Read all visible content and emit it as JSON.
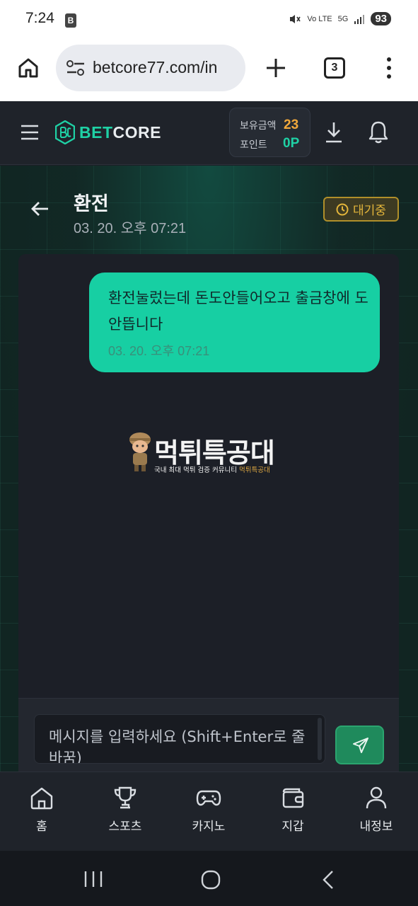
{
  "status_bar": {
    "time": "7:24",
    "app_badge": "B",
    "network": "5G",
    "volte": "Vo LTE",
    "battery": "93"
  },
  "browser": {
    "url": "betcore77.com/in",
    "tab_count": "3"
  },
  "header": {
    "logo_bet": "BET",
    "logo_core": "CORE",
    "balance_label": "보유금액",
    "balance_value": "23",
    "points_label": "포인트",
    "points_value": "0P"
  },
  "page": {
    "title": "환전",
    "timestamp": "03. 20. 오후 07:21",
    "status": "대기중",
    "status_color": "#e3b53b"
  },
  "messages": [
    {
      "text": "환전눌렀는데 돈도안들어오고 출금창에 도안뜹니다",
      "time": "03. 20. 오후 07:21",
      "bubble_color": "#17cfa3"
    }
  ],
  "watermark": {
    "brand": "먹튀특공대",
    "tagline": "국내 최대 먹튀 검증 커뮤니티 ",
    "tagline_highlight": "먹튀특공대"
  },
  "composer": {
    "placeholder": "메시지를 입력하세요 (Shift+Enter로 줄바꿈)"
  },
  "bottom_nav": [
    {
      "label": "홈",
      "icon": "home-icon"
    },
    {
      "label": "스포츠",
      "icon": "trophy-icon"
    },
    {
      "label": "카지노",
      "icon": "gamepad-icon"
    },
    {
      "label": "지갑",
      "icon": "wallet-icon"
    },
    {
      "label": "내정보",
      "icon": "user-icon"
    }
  ],
  "colors": {
    "accent": "#1fd1a5",
    "points": "#1fd1a5",
    "balance": "#f2a93b",
    "send_button": "#1f8a5c"
  }
}
